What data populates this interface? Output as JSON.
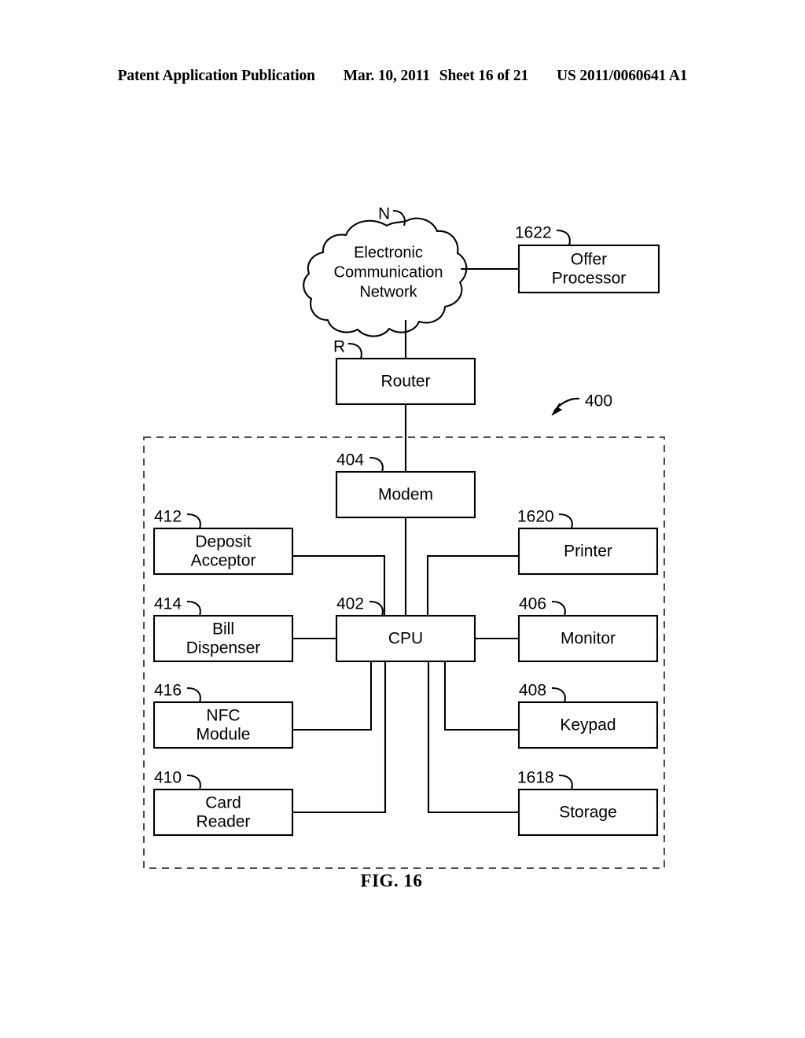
{
  "header": {
    "publication": "Patent Application Publication",
    "date": "Mar. 10, 2011",
    "sheet": "Sheet 16 of 21",
    "patent_number": "US 2011/0060641 A1"
  },
  "figure": {
    "caption": "FIG. 16",
    "enclosure_ref": "400",
    "enclosure_name": "automated-teller-machine-boundary"
  },
  "diagram": {
    "type": "block-diagram",
    "cloud": {
      "ref": "N",
      "line1": "Electronic",
      "line2": "Communication",
      "line3": "Network"
    },
    "blocks": [
      {
        "id": "offer_processor",
        "ref": "1622",
        "line1": "Offer",
        "line2": "Processor"
      },
      {
        "id": "router",
        "ref": "R",
        "line1": "Router",
        "line2": ""
      },
      {
        "id": "modem",
        "ref": "404",
        "line1": "Modem",
        "line2": ""
      },
      {
        "id": "cpu",
        "ref": "402",
        "line1": "CPU",
        "line2": ""
      },
      {
        "id": "deposit_acceptor",
        "ref": "412",
        "line1": "Deposit",
        "line2": "Acceptor"
      },
      {
        "id": "bill_dispenser",
        "ref": "414",
        "line1": "Bill",
        "line2": "Dispenser"
      },
      {
        "id": "nfc_module",
        "ref": "416",
        "line1": "NFC",
        "line2": "Module"
      },
      {
        "id": "card_reader",
        "ref": "410",
        "line1": "Card",
        "line2": "Reader"
      },
      {
        "id": "printer",
        "ref": "1620",
        "line1": "Printer",
        "line2": ""
      },
      {
        "id": "monitor",
        "ref": "406",
        "line1": "Monitor",
        "line2": ""
      },
      {
        "id": "keypad",
        "ref": "408",
        "line1": "Keypad",
        "line2": ""
      },
      {
        "id": "storage",
        "ref": "1618",
        "line1": "Storage",
        "line2": ""
      }
    ],
    "connections": [
      {
        "from": "cloud",
        "to": "offer_processor"
      },
      {
        "from": "cloud",
        "to": "router"
      },
      {
        "from": "router",
        "to": "modem"
      },
      {
        "from": "modem",
        "to": "cpu"
      },
      {
        "from": "deposit_acceptor",
        "to": "cpu"
      },
      {
        "from": "bill_dispenser",
        "to": "cpu"
      },
      {
        "from": "nfc_module",
        "to": "cpu"
      },
      {
        "from": "card_reader",
        "to": "cpu"
      },
      {
        "from": "printer",
        "to": "cpu"
      },
      {
        "from": "monitor",
        "to": "cpu"
      },
      {
        "from": "keypad",
        "to": "cpu"
      },
      {
        "from": "storage",
        "to": "cpu"
      }
    ]
  }
}
